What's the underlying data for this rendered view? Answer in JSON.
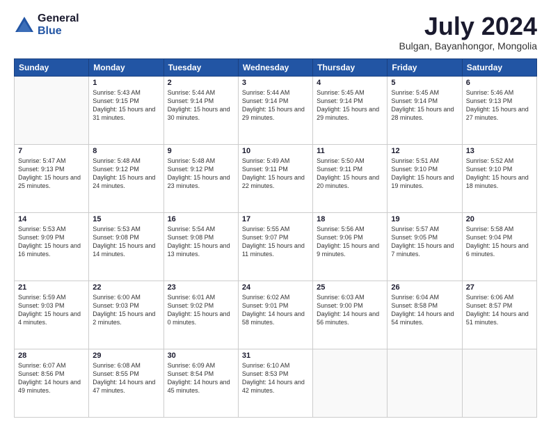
{
  "logo": {
    "general": "General",
    "blue": "Blue"
  },
  "title": "July 2024",
  "subtitle": "Bulgan, Bayanhongor, Mongolia",
  "days": [
    "Sunday",
    "Monday",
    "Tuesday",
    "Wednesday",
    "Thursday",
    "Friday",
    "Saturday"
  ],
  "weeks": [
    [
      {
        "num": "",
        "sunrise": "",
        "sunset": "",
        "daylight": ""
      },
      {
        "num": "1",
        "sunrise": "Sunrise: 5:43 AM",
        "sunset": "Sunset: 9:15 PM",
        "daylight": "Daylight: 15 hours and 31 minutes."
      },
      {
        "num": "2",
        "sunrise": "Sunrise: 5:44 AM",
        "sunset": "Sunset: 9:14 PM",
        "daylight": "Daylight: 15 hours and 30 minutes."
      },
      {
        "num": "3",
        "sunrise": "Sunrise: 5:44 AM",
        "sunset": "Sunset: 9:14 PM",
        "daylight": "Daylight: 15 hours and 29 minutes."
      },
      {
        "num": "4",
        "sunrise": "Sunrise: 5:45 AM",
        "sunset": "Sunset: 9:14 PM",
        "daylight": "Daylight: 15 hours and 29 minutes."
      },
      {
        "num": "5",
        "sunrise": "Sunrise: 5:45 AM",
        "sunset": "Sunset: 9:14 PM",
        "daylight": "Daylight: 15 hours and 28 minutes."
      },
      {
        "num": "6",
        "sunrise": "Sunrise: 5:46 AM",
        "sunset": "Sunset: 9:13 PM",
        "daylight": "Daylight: 15 hours and 27 minutes."
      }
    ],
    [
      {
        "num": "7",
        "sunrise": "Sunrise: 5:47 AM",
        "sunset": "Sunset: 9:13 PM",
        "daylight": "Daylight: 15 hours and 25 minutes."
      },
      {
        "num": "8",
        "sunrise": "Sunrise: 5:48 AM",
        "sunset": "Sunset: 9:12 PM",
        "daylight": "Daylight: 15 hours and 24 minutes."
      },
      {
        "num": "9",
        "sunrise": "Sunrise: 5:48 AM",
        "sunset": "Sunset: 9:12 PM",
        "daylight": "Daylight: 15 hours and 23 minutes."
      },
      {
        "num": "10",
        "sunrise": "Sunrise: 5:49 AM",
        "sunset": "Sunset: 9:11 PM",
        "daylight": "Daylight: 15 hours and 22 minutes."
      },
      {
        "num": "11",
        "sunrise": "Sunrise: 5:50 AM",
        "sunset": "Sunset: 9:11 PM",
        "daylight": "Daylight: 15 hours and 20 minutes."
      },
      {
        "num": "12",
        "sunrise": "Sunrise: 5:51 AM",
        "sunset": "Sunset: 9:10 PM",
        "daylight": "Daylight: 15 hours and 19 minutes."
      },
      {
        "num": "13",
        "sunrise": "Sunrise: 5:52 AM",
        "sunset": "Sunset: 9:10 PM",
        "daylight": "Daylight: 15 hours and 18 minutes."
      }
    ],
    [
      {
        "num": "14",
        "sunrise": "Sunrise: 5:53 AM",
        "sunset": "Sunset: 9:09 PM",
        "daylight": "Daylight: 15 hours and 16 minutes."
      },
      {
        "num": "15",
        "sunrise": "Sunrise: 5:53 AM",
        "sunset": "Sunset: 9:08 PM",
        "daylight": "Daylight: 15 hours and 14 minutes."
      },
      {
        "num": "16",
        "sunrise": "Sunrise: 5:54 AM",
        "sunset": "Sunset: 9:08 PM",
        "daylight": "Daylight: 15 hours and 13 minutes."
      },
      {
        "num": "17",
        "sunrise": "Sunrise: 5:55 AM",
        "sunset": "Sunset: 9:07 PM",
        "daylight": "Daylight: 15 hours and 11 minutes."
      },
      {
        "num": "18",
        "sunrise": "Sunrise: 5:56 AM",
        "sunset": "Sunset: 9:06 PM",
        "daylight": "Daylight: 15 hours and 9 minutes."
      },
      {
        "num": "19",
        "sunrise": "Sunrise: 5:57 AM",
        "sunset": "Sunset: 9:05 PM",
        "daylight": "Daylight: 15 hours and 7 minutes."
      },
      {
        "num": "20",
        "sunrise": "Sunrise: 5:58 AM",
        "sunset": "Sunset: 9:04 PM",
        "daylight": "Daylight: 15 hours and 6 minutes."
      }
    ],
    [
      {
        "num": "21",
        "sunrise": "Sunrise: 5:59 AM",
        "sunset": "Sunset: 9:03 PM",
        "daylight": "Daylight: 15 hours and 4 minutes."
      },
      {
        "num": "22",
        "sunrise": "Sunrise: 6:00 AM",
        "sunset": "Sunset: 9:03 PM",
        "daylight": "Daylight: 15 hours and 2 minutes."
      },
      {
        "num": "23",
        "sunrise": "Sunrise: 6:01 AM",
        "sunset": "Sunset: 9:02 PM",
        "daylight": "Daylight: 15 hours and 0 minutes."
      },
      {
        "num": "24",
        "sunrise": "Sunrise: 6:02 AM",
        "sunset": "Sunset: 9:01 PM",
        "daylight": "Daylight: 14 hours and 58 minutes."
      },
      {
        "num": "25",
        "sunrise": "Sunrise: 6:03 AM",
        "sunset": "Sunset: 9:00 PM",
        "daylight": "Daylight: 14 hours and 56 minutes."
      },
      {
        "num": "26",
        "sunrise": "Sunrise: 6:04 AM",
        "sunset": "Sunset: 8:58 PM",
        "daylight": "Daylight: 14 hours and 54 minutes."
      },
      {
        "num": "27",
        "sunrise": "Sunrise: 6:06 AM",
        "sunset": "Sunset: 8:57 PM",
        "daylight": "Daylight: 14 hours and 51 minutes."
      }
    ],
    [
      {
        "num": "28",
        "sunrise": "Sunrise: 6:07 AM",
        "sunset": "Sunset: 8:56 PM",
        "daylight": "Daylight: 14 hours and 49 minutes."
      },
      {
        "num": "29",
        "sunrise": "Sunrise: 6:08 AM",
        "sunset": "Sunset: 8:55 PM",
        "daylight": "Daylight: 14 hours and 47 minutes."
      },
      {
        "num": "30",
        "sunrise": "Sunrise: 6:09 AM",
        "sunset": "Sunset: 8:54 PM",
        "daylight": "Daylight: 14 hours and 45 minutes."
      },
      {
        "num": "31",
        "sunrise": "Sunrise: 6:10 AM",
        "sunset": "Sunset: 8:53 PM",
        "daylight": "Daylight: 14 hours and 42 minutes."
      },
      {
        "num": "",
        "sunrise": "",
        "sunset": "",
        "daylight": ""
      },
      {
        "num": "",
        "sunrise": "",
        "sunset": "",
        "daylight": ""
      },
      {
        "num": "",
        "sunrise": "",
        "sunset": "",
        "daylight": ""
      }
    ]
  ]
}
